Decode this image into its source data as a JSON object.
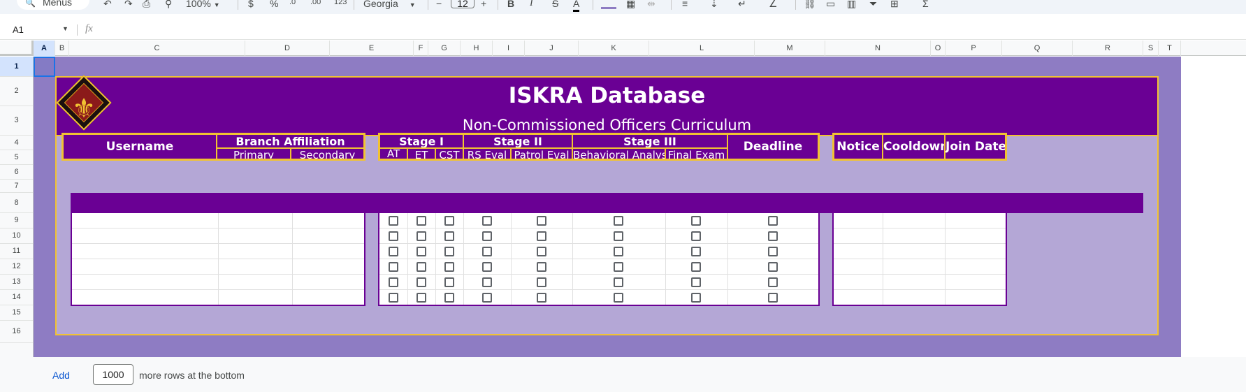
{
  "toolbar": {
    "menus_label": "Menus",
    "undo_glyph": "↶",
    "redo_glyph": "↷",
    "print_glyph": "⎙",
    "paint_format_glyph": "⚲",
    "zoom": "100%",
    "currency": "$",
    "percent": "%",
    "decimal_decrease": ".0",
    "decimal_increase": ".00",
    "number_format": "123",
    "font": "Georgia",
    "font_size_minus": "−",
    "font_size": "12",
    "font_size_plus": "+",
    "bold": "B",
    "italic": "I",
    "strike": "S",
    "text_color": "A",
    "sum": "Σ"
  },
  "formula_bar": {
    "cell_ref": "A1",
    "fx": "fx"
  },
  "columns": [
    "A",
    "B",
    "C",
    "D",
    "E",
    "F",
    "G",
    "H",
    "I",
    "J",
    "K",
    "L",
    "M",
    "N",
    "O",
    "P",
    "Q",
    "R",
    "S",
    "T"
  ],
  "rows": [
    "1",
    "2",
    "3",
    "4",
    "5",
    "6",
    "7",
    "8",
    "9",
    "10",
    "11",
    "12",
    "13",
    "14",
    "15",
    "16"
  ],
  "banner": {
    "title": "ISKRA Database",
    "subtitle": "Non-Commissioned Officers Curriculum",
    "crest_glyph": "⚜"
  },
  "headers": {
    "username": "Username",
    "branch_affiliation": "Branch Affiliation",
    "primary": "Primary",
    "secondary": "Secondary",
    "stage1": "Stage I",
    "stage2": "Stage II",
    "stage3": "Stage III",
    "at": "AT",
    "et": "ET",
    "cst": "CST",
    "rs_eval": "RS Eval",
    "patrol_eval": "Patrol Eval",
    "behavioral_analyst": "Behavioral Analyst",
    "final_exam": "Final Exam",
    "deadline": "Deadline",
    "notice": "Notice",
    "cooldown": "Cooldown",
    "join_date": "Join Date"
  },
  "footer": {
    "add_label": "Add",
    "rows_value": "1000",
    "rows_text": "more rows at the bottom"
  },
  "colors": {
    "sheet_background": "#8e7cc3",
    "panel_background": "#b4a7d6",
    "header_purple": "#6a0094",
    "gold_border": "#f1c232",
    "selection_blue": "#1a73e8"
  },
  "checkbox_rows": 6,
  "checkbox_columns": [
    "AT",
    "ET",
    "CST",
    "RS Eval",
    "Patrol Eval",
    "Behavioral Analyst",
    "Final Exam",
    "Deadline"
  ],
  "checkboxes_checked": false
}
